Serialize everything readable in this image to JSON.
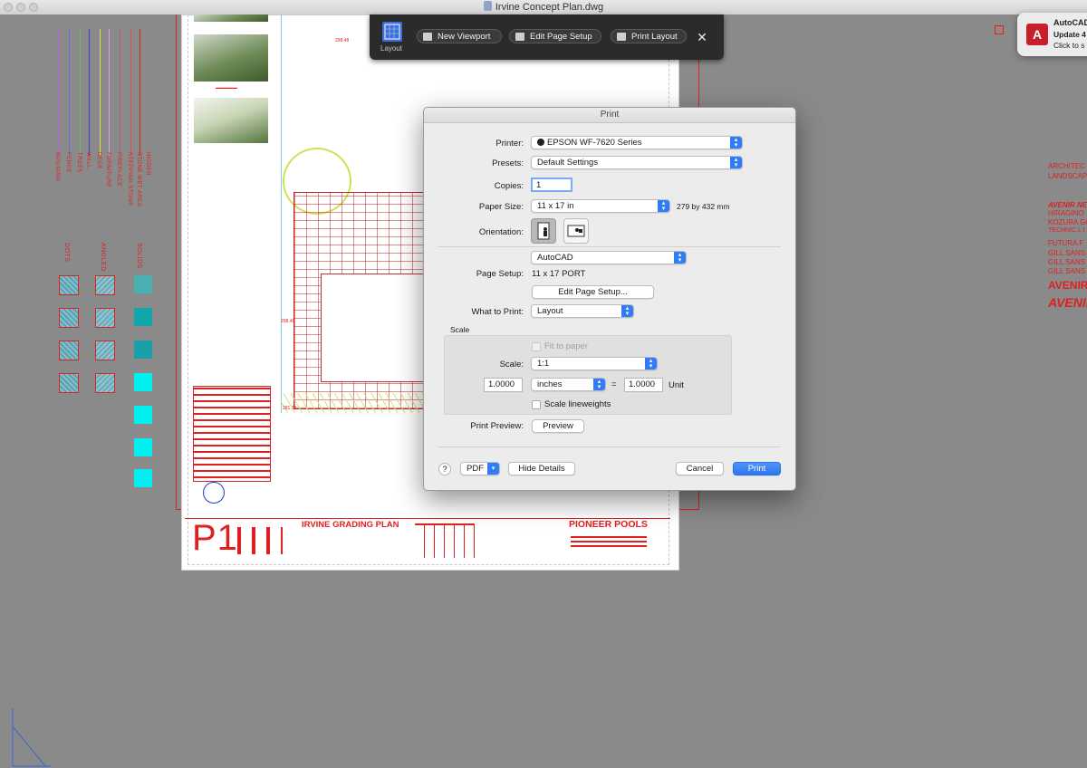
{
  "window": {
    "title": "Irvine Concept Plan.dwg"
  },
  "toolbar": {
    "layout_label": "Layout",
    "new_viewport": "New Viewport",
    "edit_page_setup": "Edit Page Setup",
    "print_layout": "Print Layout"
  },
  "notification": {
    "title": "AutoCAD",
    "line1": "Update 4",
    "line2": "Click to s"
  },
  "drawing": {
    "title_block": {
      "sheet_id": "P1",
      "plan_title": "IRVINE GRADING PLAN",
      "company": "PIONEER POOLS"
    },
    "labels": {
      "left_dim": "298.48",
      "bottom_dim": "281.72",
      "mid_dim": "298.48"
    },
    "legend_left": [
      "BUILDING",
      "FENCE",
      "TREES",
      "WALL",
      "DECK",
      "FURNITURE",
      "FIREPLACE",
      "STEPPING STONE",
      "STONE WET AREA",
      "HIDDEN"
    ],
    "legend_groups": [
      "DOTS",
      "ANGLED",
      "SOLIDS"
    ],
    "right_text": [
      "ARCHITEC",
      "LANDSCAP",
      "AVENIR NEXT",
      "HIRAGINO",
      "KOZURA GO",
      "TECHNIC L I",
      "FUTURA   F",
      "GILL SANS",
      "GILL SANS",
      "GILL SANS",
      "AVENIR",
      "AVENIR"
    ]
  },
  "print_dialog": {
    "title": "Print",
    "printer_label": "Printer:",
    "printer_value": "EPSON WF-7620 Series",
    "presets_label": "Presets:",
    "presets_value": "Default Settings",
    "copies_label": "Copies:",
    "copies_value": "1",
    "paper_size_label": "Paper Size:",
    "paper_size_value": "11 x 17 in",
    "paper_size_metric": "279 by 432 mm",
    "orientation_label": "Orientation:",
    "app_section": "AutoCAD",
    "page_setup_label": "Page Setup:",
    "page_setup_value": "11 x 17 PORT",
    "edit_page_setup_button": "Edit Page Setup...",
    "what_to_print_label": "What to Print:",
    "what_to_print_value": "Layout",
    "scale_group_label": "Scale",
    "fit_to_paper_label": "Fit to paper",
    "scale_label": "Scale:",
    "scale_value": "1:1",
    "scale_left_value": "1.0000",
    "units_value": "inches",
    "equals": "=",
    "scale_right_value": "1.0000",
    "unit_label": "Unit",
    "scale_lineweights_label": "Scale lineweights",
    "print_preview_label": "Print Preview:",
    "preview_button": "Preview",
    "help_button": "?",
    "pdf_button": "PDF",
    "hide_details_button": "Hide Details",
    "cancel_button": "Cancel",
    "print_button": "Print"
  }
}
